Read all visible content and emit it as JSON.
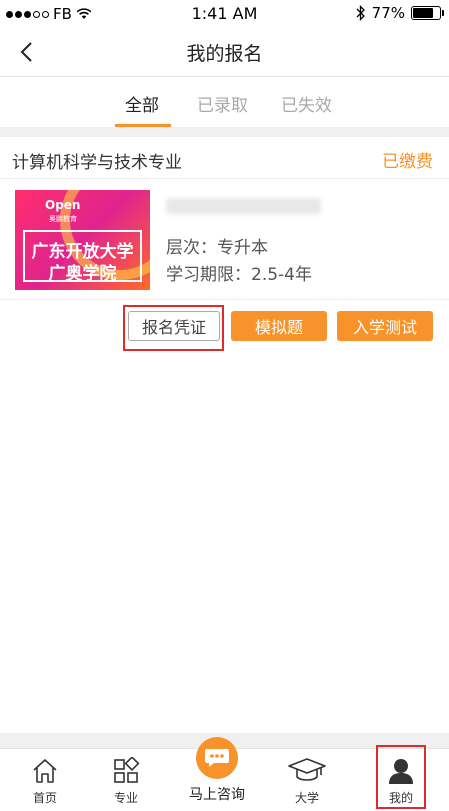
{
  "status_bar": {
    "carrier": "FB",
    "time": "1:41 AM",
    "battery": "77%"
  },
  "nav": {
    "title": "我的报名"
  },
  "tabs": [
    {
      "label": "全部",
      "active": true
    },
    {
      "label": "已录取",
      "active": false
    },
    {
      "label": "已失效",
      "active": false
    }
  ],
  "enrollment": {
    "major": "计算机科学与技术专业",
    "status": "已缴费",
    "status_color": "#f7932a",
    "thumbnail": {
      "logo": "Open",
      "logo_sub": "奥鹏教育",
      "line1": "广东开放大学",
      "line2": "广奥学院"
    },
    "level": "层次：专升本",
    "period": "学习期限：2.5-4年",
    "buttons": {
      "certificate": "报名凭证",
      "mock": "模拟题",
      "entrance_test": "入学测试"
    }
  },
  "tabbar": {
    "home": "首页",
    "major": "专业",
    "consult": "马上咨询",
    "university": "大学",
    "me": "我的"
  },
  "colors": {
    "accent": "#f7932a",
    "highlight": "#e02b2b"
  }
}
